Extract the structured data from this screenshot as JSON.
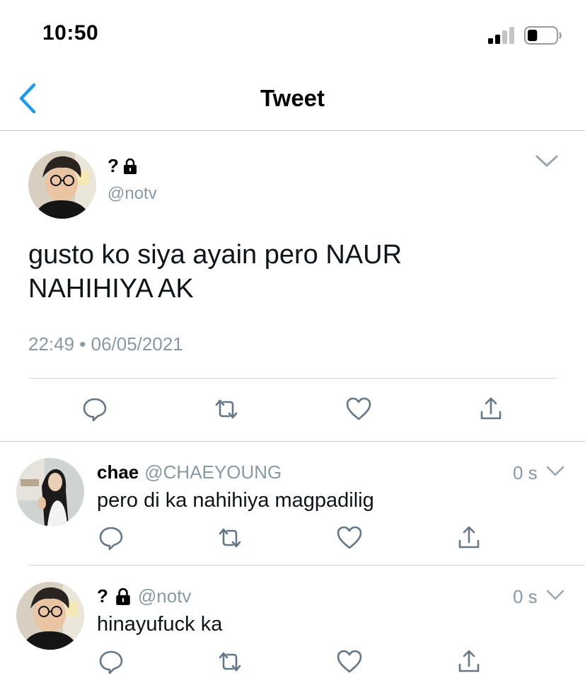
{
  "status_bar": {
    "time": "10:50",
    "battery_level": 0.35
  },
  "nav": {
    "title": "Tweet"
  },
  "main_tweet": {
    "name": "?",
    "handle": "@notv",
    "text_line1": "gusto ko siya ayain pero NAUR",
    "text_line2": "NAHIHIYA AK",
    "timestamp": "22:49 • 06/05/2021"
  },
  "replies": [
    {
      "name": "chae",
      "handle": "@CHAEYOUNG",
      "age": "0 s",
      "text": "pero di ka nahihiya magpadilig"
    },
    {
      "name": "?",
      "handle": "@notv",
      "age": "0 s",
      "text": "hinayufuck ka"
    }
  ],
  "colors": {
    "accent": "#1d9bf0",
    "icon_gray": "#8899a6",
    "divider": "#c8c8cc"
  },
  "icons": [
    "signal-icon",
    "battery-icon",
    "back-chevron-icon",
    "lock-icon",
    "chevron-down-icon",
    "reply-icon",
    "retweet-icon",
    "like-icon",
    "share-icon"
  ]
}
